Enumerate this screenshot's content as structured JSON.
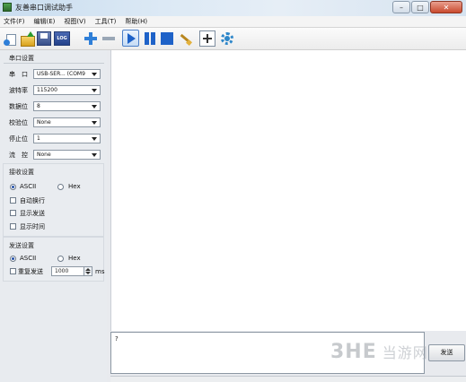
{
  "window": {
    "title": "友善串口调试助手",
    "controls": {
      "minimize": "–",
      "maximize": "□",
      "close": "✕"
    }
  },
  "menu": [
    "文件(F)",
    "编辑(E)",
    "视图(V)",
    "工具(T)",
    "帮助(H)"
  ],
  "toolbar": {
    "log_label": "LOG",
    "icons": [
      "new-icon",
      "open-icon",
      "save-icon",
      "log-icon",
      "add-icon",
      "remove-icon",
      "start-icon",
      "pause-icon",
      "stop-icon",
      "clear-icon",
      "add-frame-icon",
      "settings-icon"
    ]
  },
  "serial_settings": {
    "title": "串口设置",
    "fields": [
      {
        "label": "串　口",
        "value": "USB-SER... (COM9"
      },
      {
        "label": "波特率",
        "value": "115200"
      },
      {
        "label": "数据位",
        "value": "8"
      },
      {
        "label": "校验位",
        "value": "None"
      },
      {
        "label": "停止位",
        "value": "1"
      },
      {
        "label": "流　控",
        "value": "None"
      }
    ]
  },
  "receive_settings": {
    "title": "接收设置",
    "mode_ascii": "ASCII",
    "mode_hex": "Hex",
    "selected_mode": "ASCII",
    "auto_newline": "自动换行",
    "show_send": "显示发送",
    "show_time": "显示时间"
  },
  "send_settings": {
    "title": "发送设置",
    "mode_ascii": "ASCII",
    "mode_hex": "Hex",
    "selected_mode": "ASCII",
    "repeat_label": "重复发送",
    "repeat_interval": "1000",
    "repeat_unit": "ms"
  },
  "send_area": {
    "text": "?",
    "button": "发送"
  },
  "watermark": {
    "logo": "3HE",
    "text": "当游网"
  }
}
